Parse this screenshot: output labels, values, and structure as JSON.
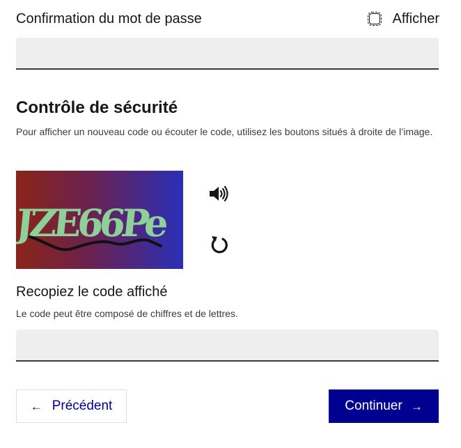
{
  "password_confirm": {
    "label": "Confirmation du mot de passe",
    "show_label": "Afficher",
    "value": ""
  },
  "security": {
    "title": "Contrôle de sécurité",
    "help": "Pour afficher un nouveau code ou écouter le code, utilisez les boutons situés à droite de l’image.",
    "captcha_text": "JZE66Pe",
    "audio_icon": "speaker-icon",
    "refresh_icon": "refresh-icon"
  },
  "code": {
    "label": "Recopiez le code affiché",
    "hint": "Le code peut être composé de chiffres et de lettres.",
    "value": ""
  },
  "actions": {
    "previous_label": "Précédent",
    "next_label": "Continuer"
  },
  "colors": {
    "primary": "#000091",
    "input_bg": "#eeeeee"
  }
}
